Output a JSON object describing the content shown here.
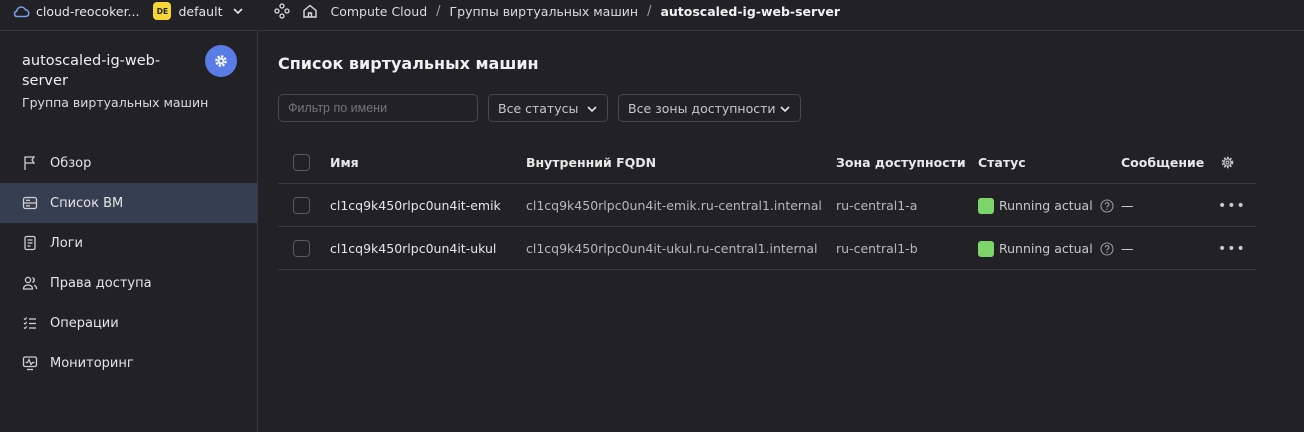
{
  "topbar": {
    "cloud_name": "cloud-reocoker...",
    "folder_badge": "DE",
    "folder_name": "default",
    "breadcrumbs": [
      "Compute Cloud",
      "Группы виртуальных машин",
      "autoscaled-ig-web-server"
    ],
    "separator": "/"
  },
  "sidebar": {
    "title": "autoscaled-ig-web-server",
    "subtitle": "Группа виртуальных машин",
    "items": [
      {
        "label": "Обзор",
        "icon": "flag-icon"
      },
      {
        "label": "Список ВМ",
        "icon": "vm-list-icon",
        "active": true
      },
      {
        "label": "Логи",
        "icon": "logs-icon"
      },
      {
        "label": "Права доступа",
        "icon": "users-icon"
      },
      {
        "label": "Операции",
        "icon": "operations-list-icon"
      },
      {
        "label": "Мониторинг",
        "icon": "monitoring-icon"
      }
    ]
  },
  "main": {
    "title": "Список виртуальных машин",
    "filter_placeholder": "Фильтр по имени",
    "status_select": "Все статусы",
    "zone_select": "Все зоны доступности",
    "columns": [
      "Имя",
      "Внутренний FQDN",
      "Зона доступности",
      "Статус",
      "Сообщение"
    ],
    "rows": [
      {
        "name": "cl1cq9k450rlpc0un4it-emik",
        "fqdn": "cl1cq9k450rlpc0un4it-emik.ru-central1.internal",
        "zone": "ru-central1-a",
        "status": "Running actual",
        "message": "—",
        "actions": "•••"
      },
      {
        "name": "cl1cq9k450rlpc0un4it-ukul",
        "fqdn": "cl1cq9k450rlpc0un4it-ukul.ru-central1.internal",
        "zone": "ru-central1-b",
        "status": "Running actual",
        "message": "—",
        "actions": "•••"
      }
    ]
  },
  "colors": {
    "background": "#222126",
    "accent": "#5a7ce6",
    "active_nav": "#363e52",
    "status_running": "#7dd46a",
    "folder_badge": "#f5d73a"
  }
}
